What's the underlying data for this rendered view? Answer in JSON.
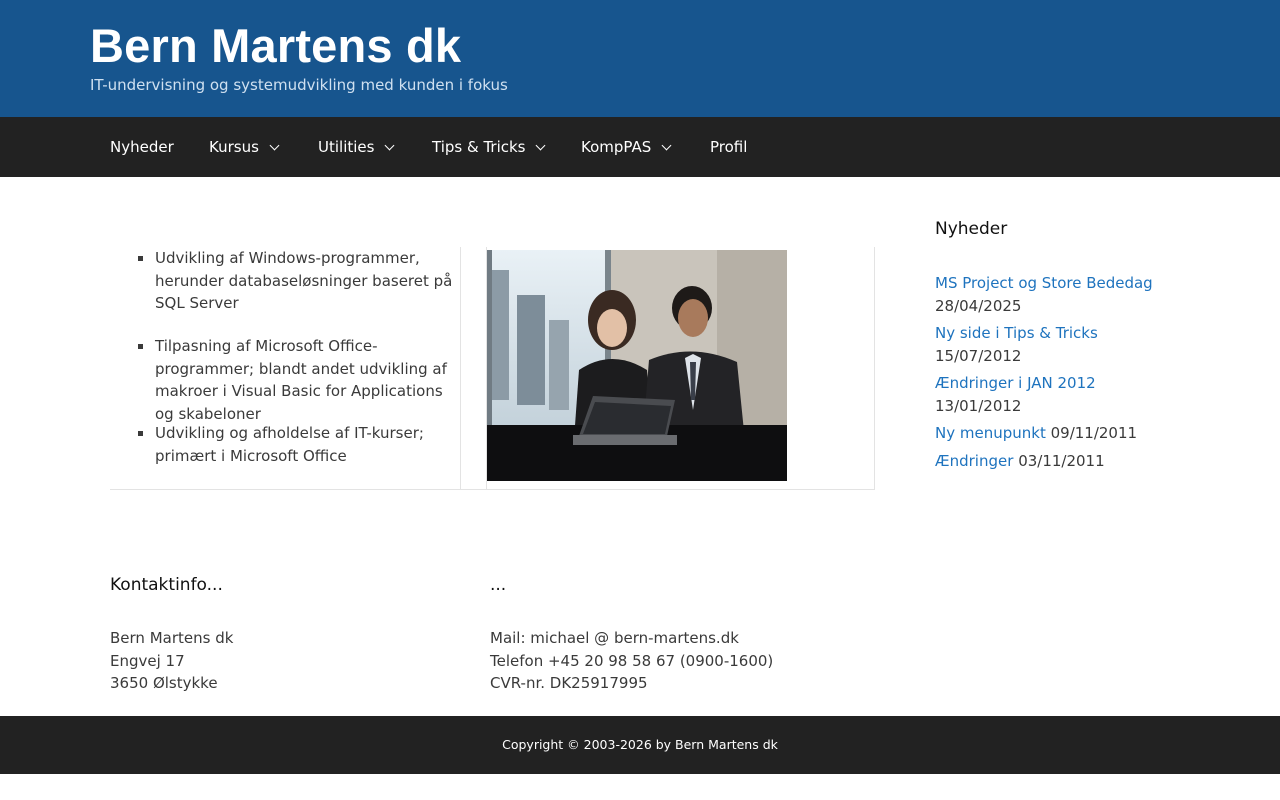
{
  "header": {
    "title": "Bern Martens dk",
    "tagline": "IT-undervisning og systemudvikling med kunden i fokus"
  },
  "nav": {
    "items": [
      {
        "label": "Nyheder",
        "has_dropdown": false
      },
      {
        "label": "Kursus",
        "has_dropdown": true
      },
      {
        "label": "Utilities",
        "has_dropdown": true
      },
      {
        "label": "Tips & Tricks",
        "has_dropdown": true
      },
      {
        "label": "KompPAS",
        "has_dropdown": true
      },
      {
        "label": "Profil",
        "has_dropdown": false
      }
    ]
  },
  "main": {
    "bullets": [
      "Udvikling af Windows-programmer, herunder databaseløsninger baseret på SQL Server",
      "Tilpasning af Microsoft Office-programmer; blandt andet udvikling af makroer i Visual Basic for Applications og skabeloner",
      "Udvikling og afholdelse af IT-kurser; primært i Microsoft Office"
    ]
  },
  "sidebar": {
    "title": "Nyheder",
    "news": [
      {
        "link": "MS Project og Store Bededag",
        "date": "28/04/2025"
      },
      {
        "link": "Ny side i Tips & Tricks",
        "date": "15/07/2012"
      },
      {
        "link": "Ændringer i JAN 2012",
        "date": "13/01/2012"
      },
      {
        "link": "Ny menupunkt",
        "date": "09/11/2011"
      },
      {
        "link": "Ændringer",
        "date": "03/11/2011"
      }
    ]
  },
  "footer_widgets": {
    "contact": {
      "title": "Kontaktinfo...",
      "lines": [
        "Bern Martens dk",
        "Engvej 17",
        "3650 Ølstykke"
      ]
    },
    "more": {
      "title": "...",
      "lines": [
        "Mail: michael @ bern-martens.dk",
        "Telefon +45 20 98 58 67 (0900-1600)",
        "CVR-nr. DK25917995"
      ]
    }
  },
  "footer": {
    "copyright": "Copyright © 2003-2026 by Bern Martens dk"
  },
  "colors": {
    "header_bg": "#17558e",
    "nav_bg": "#222222",
    "link": "#1e73be",
    "text": "#3a3a3a"
  }
}
